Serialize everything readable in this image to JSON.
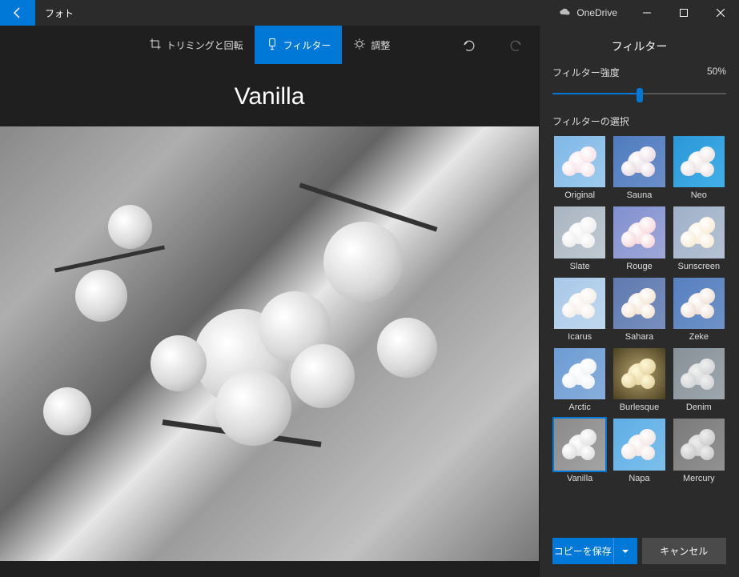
{
  "titlebar": {
    "app_name": "フォト",
    "onedrive_label": "OneDrive"
  },
  "toolbar": {
    "tabs": [
      {
        "id": "crop",
        "label": "トリミングと回転",
        "selected": false
      },
      {
        "id": "filter",
        "label": "フィルター",
        "selected": true
      },
      {
        "id": "adjust",
        "label": "調整",
        "selected": false
      }
    ]
  },
  "canvas": {
    "current_filter_name": "Vanilla"
  },
  "side": {
    "title": "フィルター",
    "strength_label": "フィルター強度",
    "strength_value": "50%",
    "strength_percent": 50,
    "select_label": "フィルターの選択",
    "filters": [
      {
        "id": "original",
        "label": "Original",
        "cls": "f-original",
        "selected": false
      },
      {
        "id": "sauna",
        "label": "Sauna",
        "cls": "f-sauna",
        "selected": false
      },
      {
        "id": "neo",
        "label": "Neo",
        "cls": "f-neo",
        "selected": false
      },
      {
        "id": "slate",
        "label": "Slate",
        "cls": "f-slate",
        "selected": false
      },
      {
        "id": "rouge",
        "label": "Rouge",
        "cls": "f-rouge",
        "selected": false
      },
      {
        "id": "sunscreen",
        "label": "Sunscreen",
        "cls": "f-sunscreen",
        "selected": false
      },
      {
        "id": "icarus",
        "label": "Icarus",
        "cls": "f-icarus",
        "selected": false
      },
      {
        "id": "sahara",
        "label": "Sahara",
        "cls": "f-sahara",
        "selected": false
      },
      {
        "id": "zeke",
        "label": "Zeke",
        "cls": "f-zeke",
        "selected": false
      },
      {
        "id": "arctic",
        "label": "Arctic",
        "cls": "f-arctic",
        "selected": false
      },
      {
        "id": "burlesque",
        "label": "Burlesque",
        "cls": "f-burlesque",
        "selected": false
      },
      {
        "id": "denim",
        "label": "Denim",
        "cls": "f-denim",
        "selected": false
      },
      {
        "id": "vanilla",
        "label": "Vanilla",
        "cls": "f-vanilla",
        "selected": true
      },
      {
        "id": "napa",
        "label": "Napa",
        "cls": "f-napa",
        "selected": false
      },
      {
        "id": "mercury",
        "label": "Mercury",
        "cls": "f-mercury",
        "selected": false
      }
    ]
  },
  "footer": {
    "save_label": "コピーを保存",
    "cancel_label": "キャンセル"
  },
  "colors": {
    "accent": "#0078d7"
  }
}
